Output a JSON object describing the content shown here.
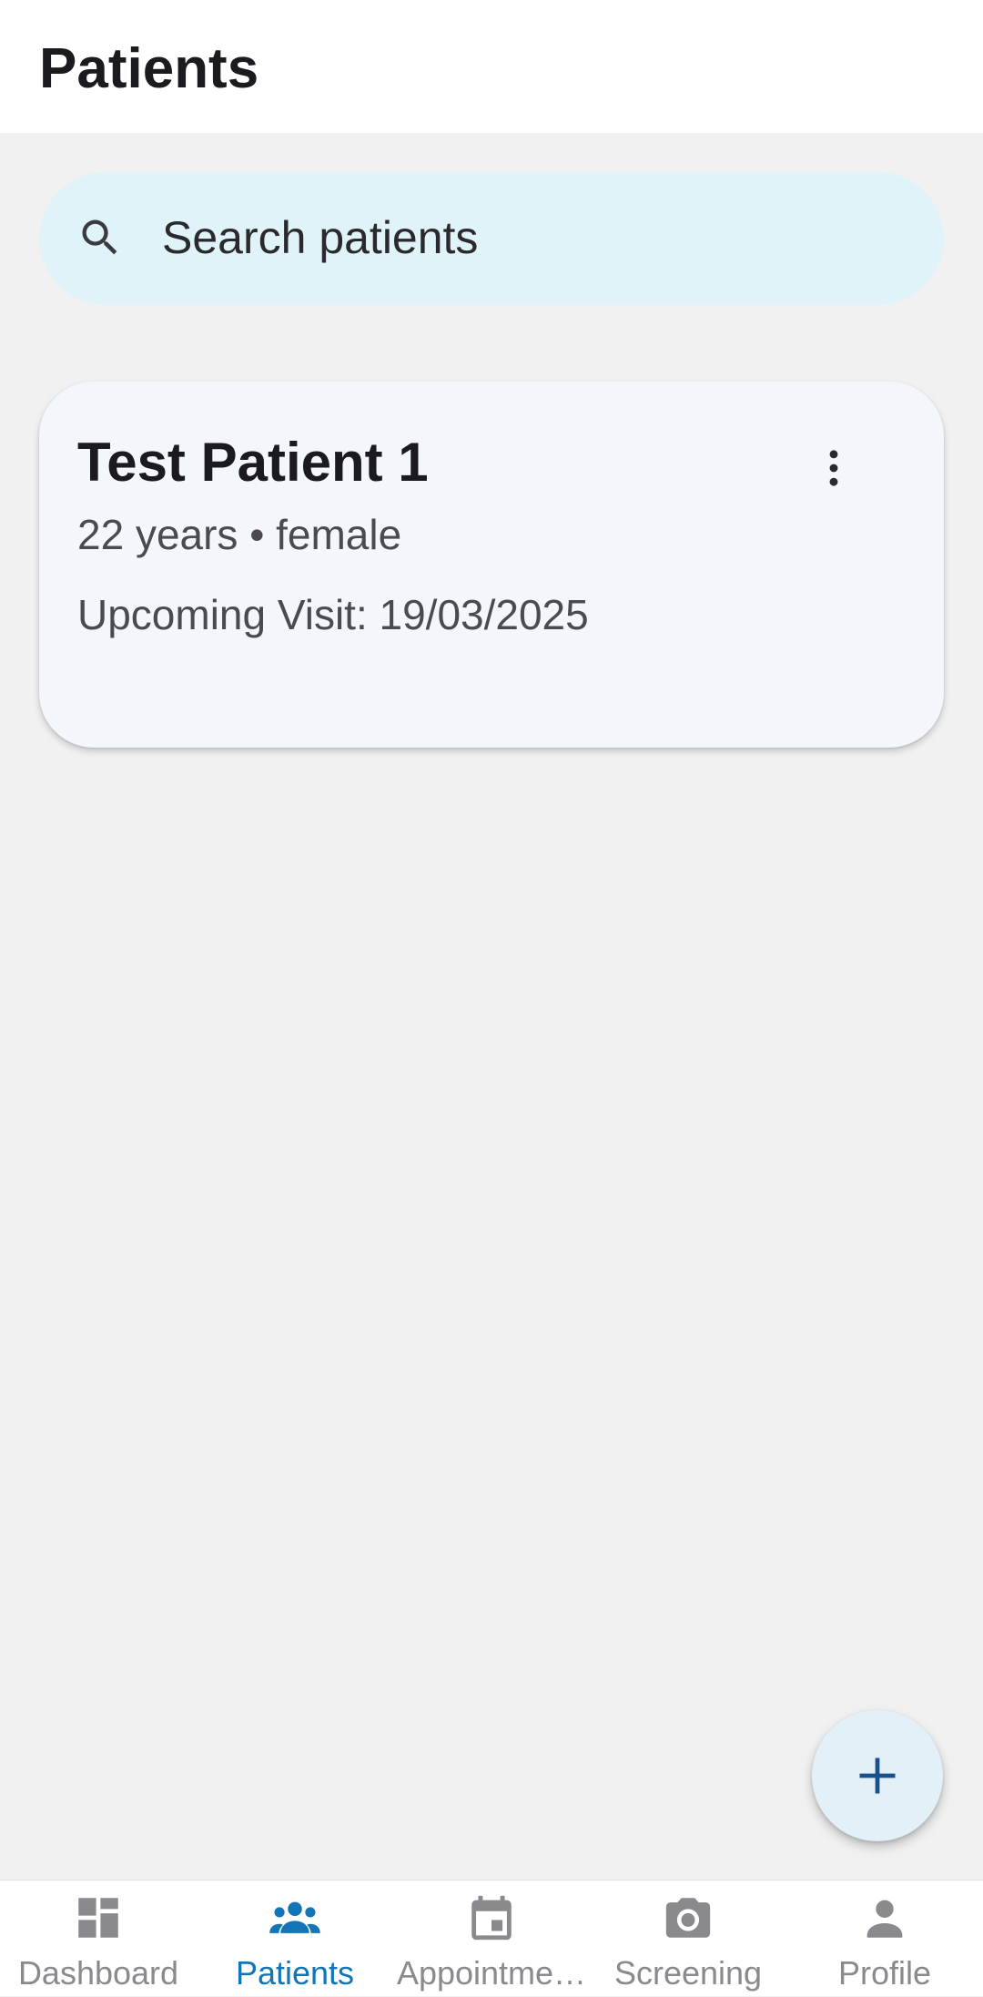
{
  "header": {
    "title": "Patients"
  },
  "search": {
    "placeholder": "Search patients",
    "value": "",
    "icon": "search-icon"
  },
  "patients": [
    {
      "name": "Test Patient 1",
      "details": "22 years • female",
      "upcoming_visit": "Upcoming Visit: 19/03/2025",
      "menu_icon": "more-vert-icon"
    }
  ],
  "fab": {
    "icon": "add-icon"
  },
  "bottom_nav": {
    "active": "Patients",
    "items": [
      {
        "label": "Dashboard",
        "icon": "dashboard-icon"
      },
      {
        "label": "Patients",
        "icon": "people-icon"
      },
      {
        "label": "Appointme…",
        "icon": "calendar-icon"
      },
      {
        "label": "Screening",
        "icon": "camera-icon"
      },
      {
        "label": "Profile",
        "icon": "person-icon"
      }
    ]
  },
  "colors": {
    "background": "#f1f1f1",
    "app_bar": "#ffffff",
    "search_fill": "#dff3f9",
    "card_fill": "#f3f6fa",
    "active_nav": "#1275b8",
    "inactive_nav": "#8a8a8e",
    "fab_fill": "#e3f0f7",
    "fab_icon": "#1a4f8a"
  }
}
